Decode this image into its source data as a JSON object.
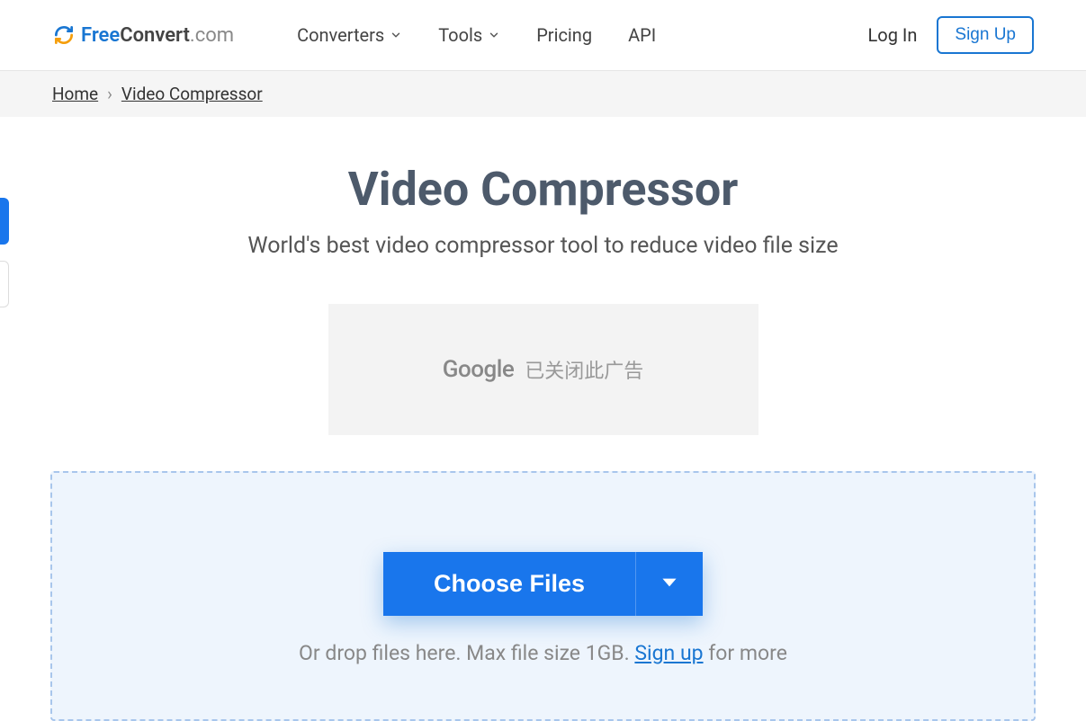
{
  "logo": {
    "free": "Free",
    "convert": "Convert",
    "com": ".com"
  },
  "nav": {
    "converters": "Converters",
    "tools": "Tools",
    "pricing": "Pricing",
    "api": "API"
  },
  "auth": {
    "login": "Log In",
    "signup": "Sign Up"
  },
  "breadcrumb": {
    "home": "Home",
    "current": "Video Compressor"
  },
  "page": {
    "title": "Video Compressor",
    "subtitle": "World's best video compressor tool to reduce video file size"
  },
  "ad": {
    "google": "Google",
    "closed_text": "已关闭此广告"
  },
  "upload": {
    "choose": "Choose Files",
    "drop_prefix": "Or drop files here. Max file size 1GB. ",
    "signup_link": "Sign up",
    "drop_suffix": " for more"
  }
}
